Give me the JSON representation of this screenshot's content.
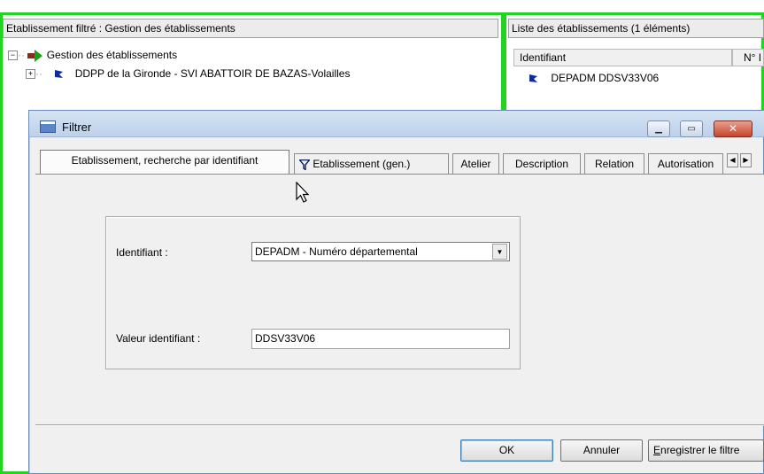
{
  "left_panel": {
    "header": "Etablissement filtré : Gestion des établissements",
    "tree": {
      "root_label": "Gestion des établissements",
      "child_label": "DDPP de la Gironde - SVI ABATTOIR DE BAZAS-Volailles"
    }
  },
  "right_panel": {
    "header": "Liste des établissements  (1 éléments)",
    "columns": [
      "Identifiant",
      "N° I"
    ],
    "rows": [
      "DEPADM DDSV33V06"
    ]
  },
  "dialog": {
    "title": "Filtrer",
    "tabs": [
      "Etablissement, recherche par identifiant",
      "Etablissement (gen.)",
      "Atelier",
      "Description",
      "Relation",
      "Autorisation"
    ],
    "form": {
      "identifiant_label": "Identifiant :",
      "identifiant_value": "DEPADM - Numéro départemental",
      "valeur_label": "Valeur identifiant :",
      "valeur_value": "DDSV33V06"
    },
    "buttons": {
      "ok": "OK",
      "cancel": "Annuler",
      "save_filter": "Enregistrer le filtre"
    }
  },
  "colors": {
    "highlight_frame": "#22d322",
    "title_bar": "#c7d8ee",
    "close_button": "#c7442c"
  },
  "icons": [
    "arrow-icon",
    "blue-flag-icon",
    "filter-funnel-icon",
    "dialog-window-icon",
    "mouse-cursor-icon"
  ]
}
